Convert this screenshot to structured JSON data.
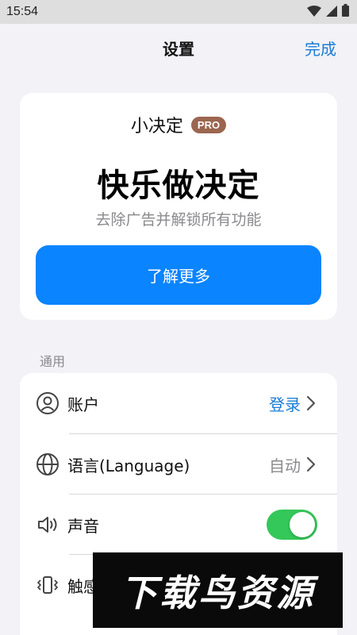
{
  "status_bar": {
    "time": "15:54",
    "icons": [
      "wifi-icon",
      "signal-icon",
      "battery-icon"
    ]
  },
  "nav": {
    "title": "设置",
    "done_label": "完成"
  },
  "pro_card": {
    "app_name": "小决定",
    "badge": "PRO",
    "headline": "快乐做决定",
    "subtitle": "去除广告并解锁所有功能",
    "button_label": "了解更多"
  },
  "general_section": {
    "label": "通用",
    "rows": [
      {
        "icon": "account-icon",
        "label": "账户",
        "value": "登录",
        "has_chevron": true
      },
      {
        "icon": "globe-icon",
        "label": "语言(Language)",
        "value": "自动",
        "has_chevron": true
      },
      {
        "icon": "speaker-icon",
        "label": "声音",
        "toggle_on": true
      },
      {
        "icon": "vibration-icon",
        "label": "触感"
      }
    ]
  },
  "watermark": "下载鸟资源",
  "colors": {
    "accent": "#0a84ff",
    "link": "#1a7cd6",
    "toggle_on": "#34c759",
    "badge": "#9b6650",
    "background": "#f2f2f7"
  }
}
